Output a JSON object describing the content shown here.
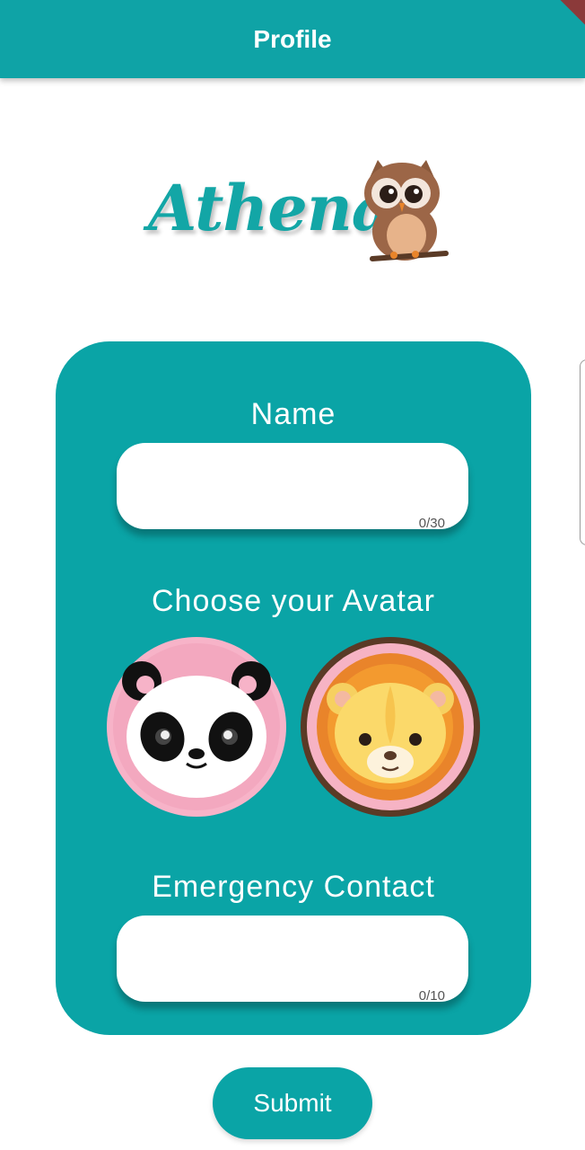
{
  "appbar": {
    "title": "Profile"
  },
  "logo": {
    "text": "Athena"
  },
  "form": {
    "name_label": "Name",
    "name_counter": "0/30",
    "avatar_label": "Choose your Avatar",
    "avatars": [
      "panda",
      "lion"
    ],
    "contact_label": "Emergency  Contact",
    "contact_counter": "0/10"
  },
  "submit_label": "Submit",
  "colors": {
    "primary": "#0fa3a6",
    "panda_bg": "#f7b3c8",
    "lion_mane": "#e9842a"
  }
}
